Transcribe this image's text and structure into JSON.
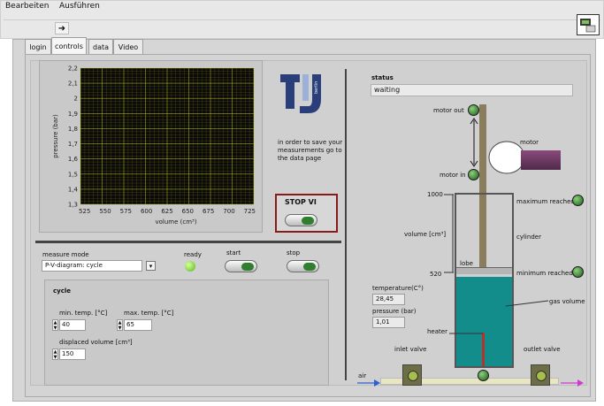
{
  "menu": {
    "items": [
      {
        "label": "Bearbeiten"
      },
      {
        "label": "Ausführen"
      }
    ]
  },
  "tabs": [
    {
      "label": "login"
    },
    {
      "label": "controls"
    },
    {
      "label": "data"
    },
    {
      "label": "Video"
    }
  ],
  "active_tab": "controls",
  "chart_data": {
    "type": "line",
    "xlabel": "volume (cm³)",
    "ylabel": "pressure (bar)",
    "x_ticks": [
      "525",
      "550",
      "575",
      "600",
      "625",
      "650",
      "675",
      "700",
      "725"
    ],
    "y_ticks": [
      "2,2",
      "2,1",
      "2",
      "1,9",
      "1,8",
      "1,7",
      "1,6",
      "1,5",
      "1,4",
      "1,3"
    ],
    "xlim": [
      520,
      730
    ],
    "ylim": [
      1.3,
      2.2
    ],
    "grid": true,
    "background": "#0a0a0a",
    "grid_color": "#c8c818",
    "series": []
  },
  "logo": {
    "text": "berlin"
  },
  "note": "in order to save your measurements go to the data page",
  "stop_label": "STOP VI",
  "controls": {
    "measure_mode_label": "measure mode",
    "measure_mode_value": "P-V-diagram: cycle",
    "ready_label": "ready",
    "start_label": "start",
    "stop_label": "stop"
  },
  "cycle": {
    "title": "cycle",
    "min_temp_label": "min. temp. [°C]",
    "min_temp_value": "40",
    "max_temp_label": "max. temp. [°C]",
    "max_temp_value": "65",
    "displaced_label": "displaced volume [cm³]",
    "displaced_value": "150"
  },
  "status": {
    "label": "status",
    "value": "waiting"
  },
  "machine": {
    "motor_out": "motor out",
    "motor_in": "motor in",
    "motor": "motor",
    "v1000": "1000",
    "v520": "520",
    "volume_label": "volume [cm³]",
    "maximum": "maximum reached",
    "minimum": "minimum reached",
    "cylinder": "cylinder",
    "lobe": "lobe",
    "gas_volume": "gas volume",
    "heater": "heater",
    "temperature_label": "temperature(C°)",
    "temperature_value": "28,45",
    "pressure_label": "pressure (bar)",
    "pressure_value": "1,01",
    "inlet": "inlet valve",
    "outlet": "outlet valve",
    "air": "air"
  },
  "colors": {
    "accent_green": "#2f7f2f",
    "gas": "#138d8b",
    "stop_border": "#8a1a1a"
  }
}
